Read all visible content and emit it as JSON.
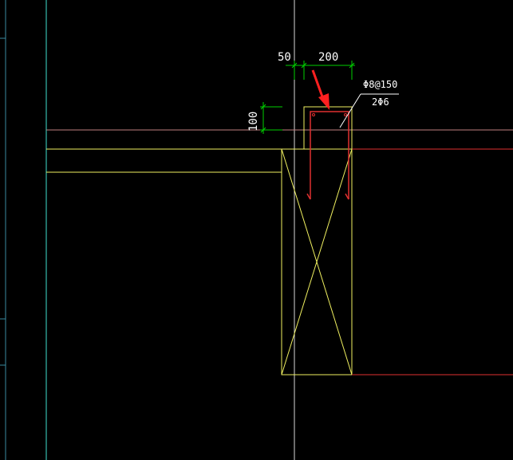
{
  "canvas": {
    "background": "#000000"
  },
  "colors": {
    "dimension": "#00d000",
    "dimension_text": "#ffffff",
    "outline": "#f0f060",
    "rebar": "#e03030",
    "gridline": "#40e0d0",
    "slab_line": "#c08080",
    "pointer_arrow": "#ff2020",
    "leader": "#ffffff",
    "frame_edge": "#3a8aa0"
  },
  "dimensions": {
    "left_offset": "50",
    "beam_width": "200",
    "slab_thickness": "100"
  },
  "annotations": {
    "stirrup_spec": "Φ8@150",
    "bar_spec": "2Φ6"
  },
  "icons": {
    "pointer": "red-arrow-icon"
  }
}
